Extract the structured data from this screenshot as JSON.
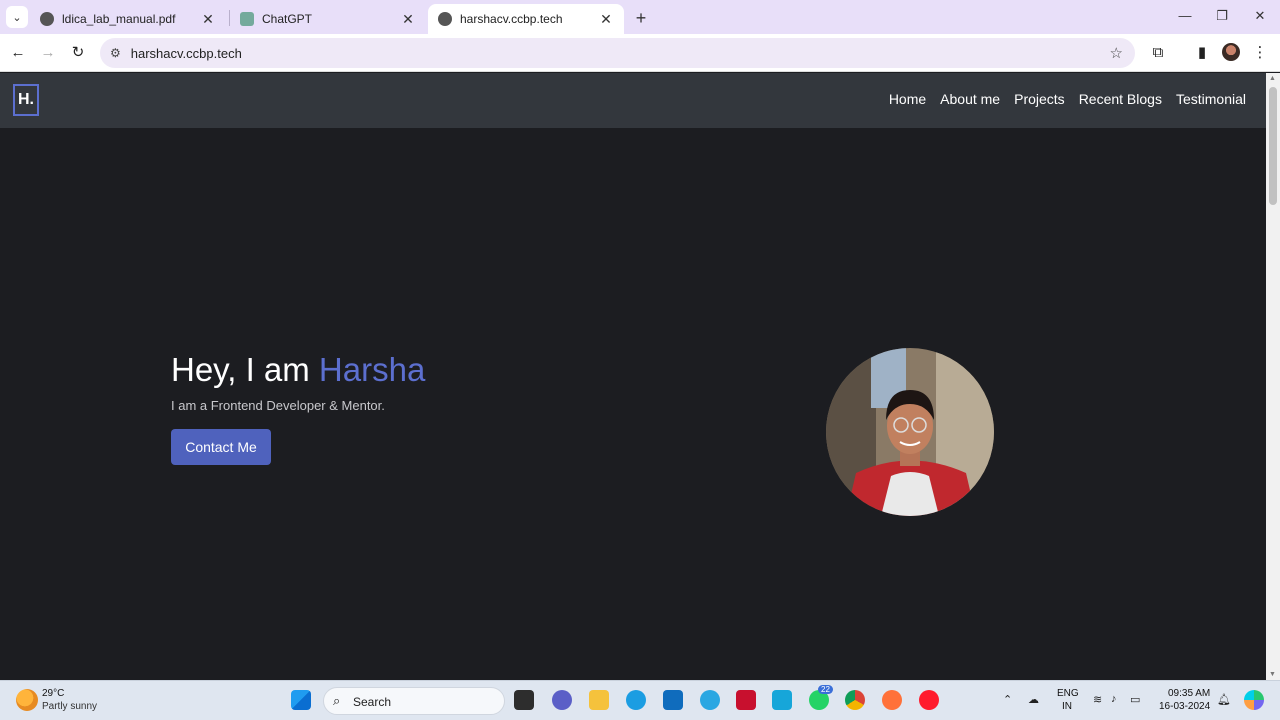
{
  "browser": {
    "tabs": [
      {
        "title": "ldica_lab_manual.pdf",
        "active": false
      },
      {
        "title": "ChatGPT",
        "active": false
      },
      {
        "title": "harshacv.ccbp.tech",
        "active": true
      }
    ],
    "close_glyph": "✕",
    "new_tab_glyph": "+",
    "address": "harshacv.ccbp.tech"
  },
  "site": {
    "logo": "H.",
    "nav": [
      "Home",
      "About me",
      "Projects",
      "Recent Blogs",
      "Testimonial"
    ],
    "hero": {
      "greeting": "Hey, I am ",
      "name": "Harsha",
      "subtitle": "I am a Frontend Developer & Mentor.",
      "cta": "Contact Me"
    },
    "colors": {
      "accent": "#5c6fcf",
      "navbar": "#33373d",
      "background": "#1c1d21"
    }
  },
  "taskbar": {
    "weather": {
      "temp": "29°C",
      "desc": "Partly sunny"
    },
    "search_label": "Search",
    "whatsapp_badge": "22",
    "lang": {
      "line1": "ENG",
      "line2": "IN"
    },
    "time": "09:35 AM",
    "date": "16-03-2024"
  }
}
